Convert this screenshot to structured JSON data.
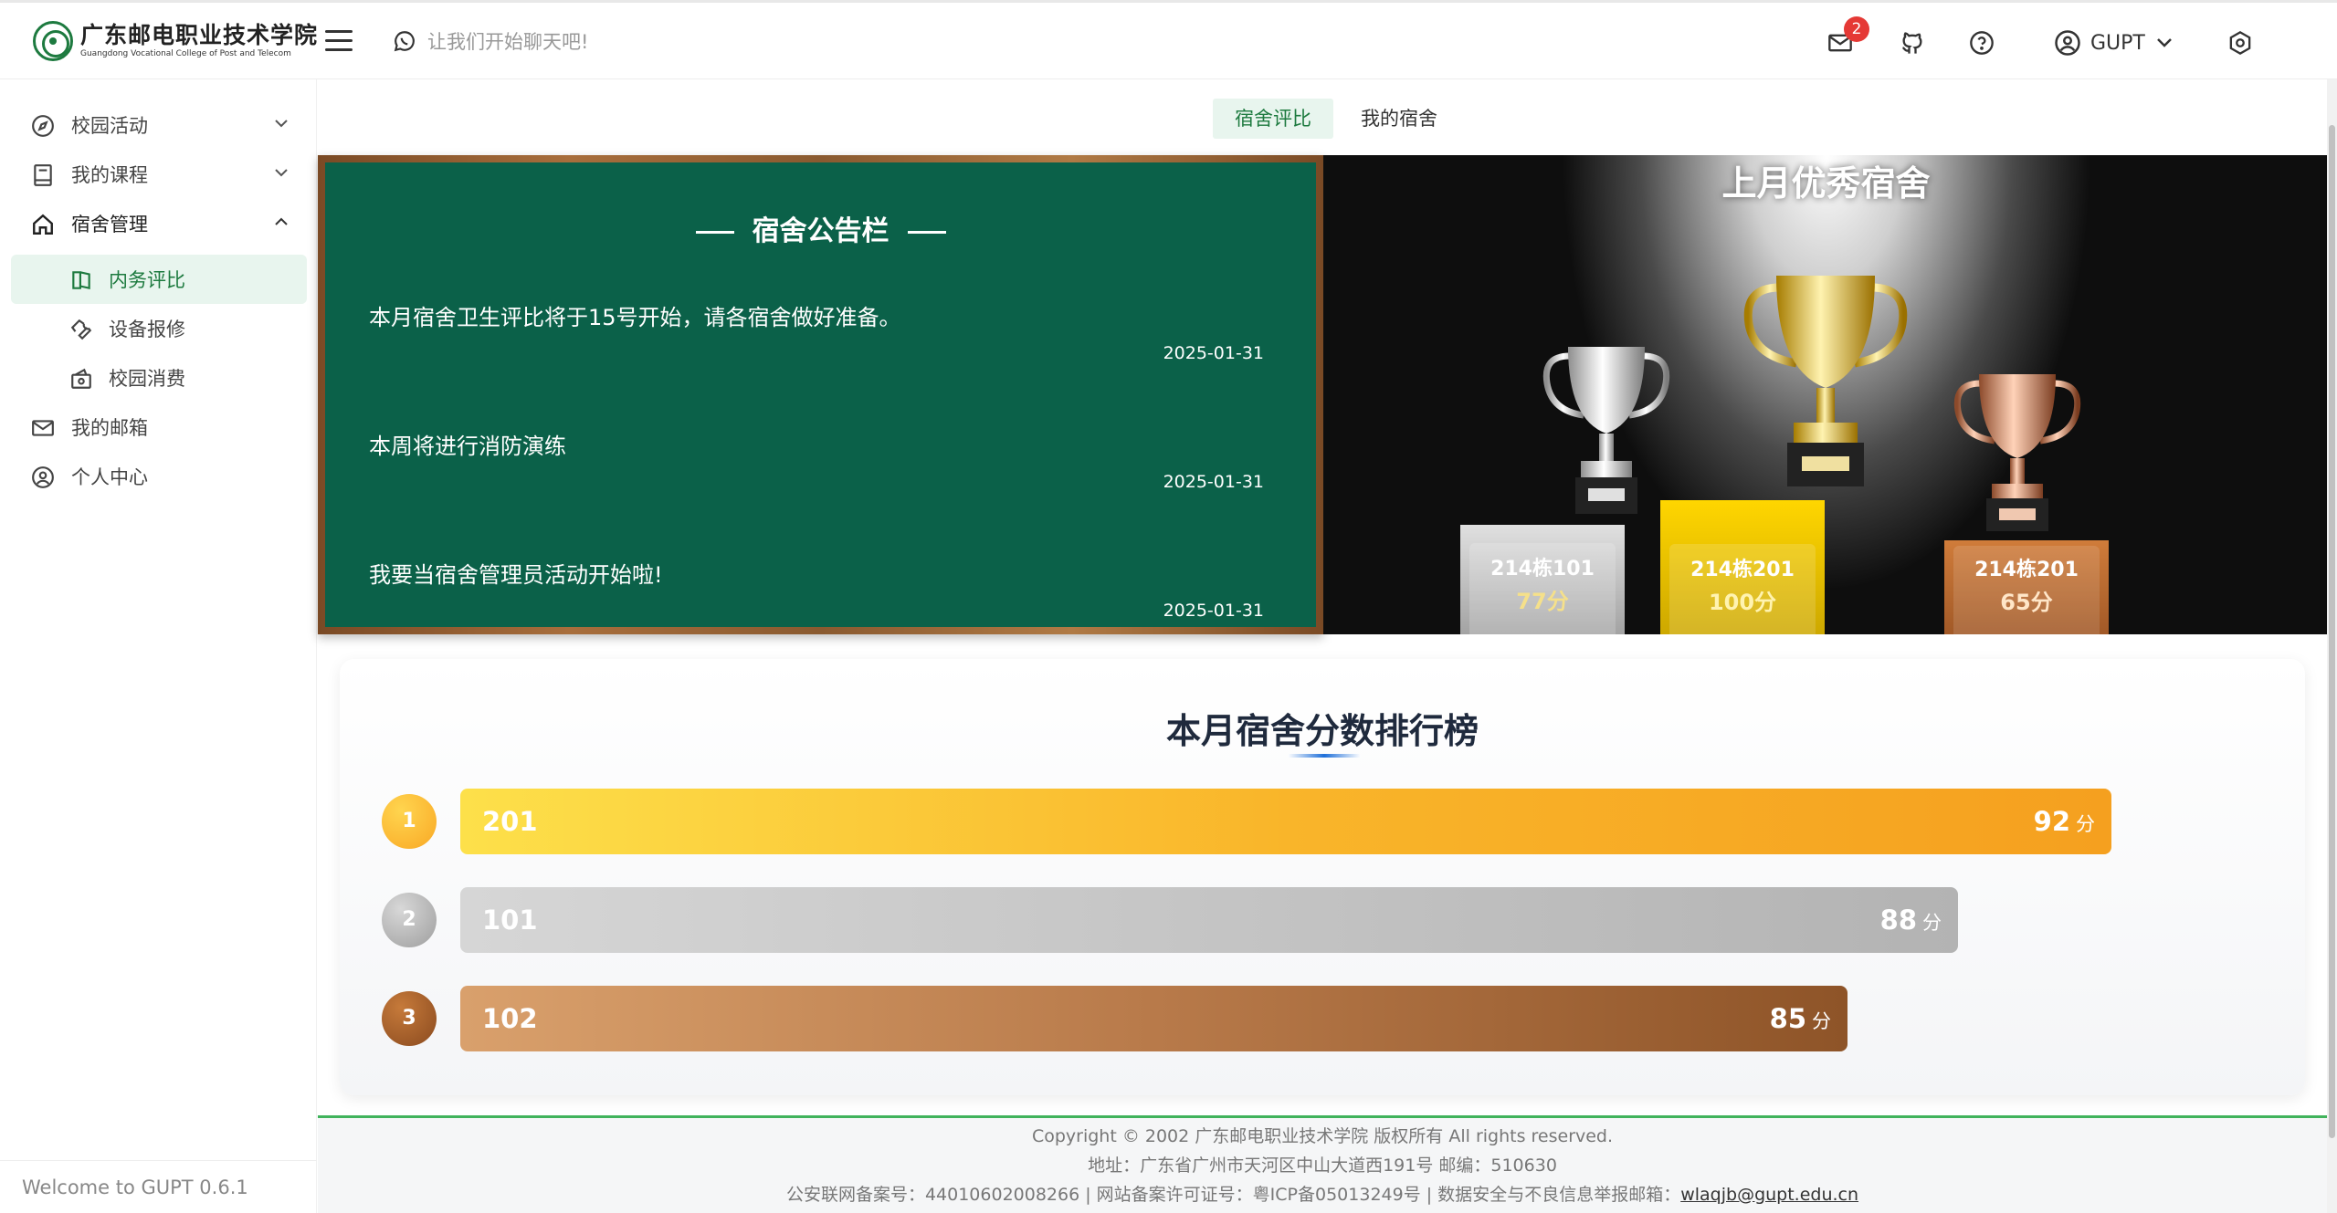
{
  "header": {
    "logo_cn": "广东邮电职业技术学院",
    "logo_en": "Guangdong Vocational College of Post and Telecom",
    "chat_placeholder": "让我们开始聊天吧!",
    "mail_badge": "2",
    "user_name": "GUPT"
  },
  "sidebar": {
    "items": [
      {
        "label": "校园活动"
      },
      {
        "label": "我的课程"
      },
      {
        "label": "宿舍管理"
      },
      {
        "label": "内务评比"
      },
      {
        "label": "设备报修"
      },
      {
        "label": "校园消费"
      },
      {
        "label": "我的邮箱"
      },
      {
        "label": "个人中心"
      }
    ],
    "welcome": "Welcome to GUPT 0.6.1"
  },
  "tabs": [
    {
      "label": "宿舍评比",
      "active": true
    },
    {
      "label": "我的宿舍",
      "active": false
    }
  ],
  "bulletin": {
    "title": "宿舍公告栏",
    "notices": [
      {
        "text": "本月宿舍卫生评比将于15号开始，请各宿舍做好准备。",
        "date": "2025-01-31"
      },
      {
        "text": "本周将进行消防演练",
        "date": "2025-01-31"
      },
      {
        "text": "我要当宿舍管理员活动开始啦!",
        "date": "2025-01-31"
      }
    ]
  },
  "trophies": {
    "title": "上月优秀宿舍",
    "podiums": [
      {
        "name": "214栋101",
        "score": "77分",
        "medal": "silver"
      },
      {
        "name": "214栋201",
        "score": "100分",
        "medal": "gold"
      },
      {
        "name": "214栋201",
        "score": "65分",
        "medal": "bronze"
      }
    ]
  },
  "ranking": {
    "title": "本月宿舍分数排行榜",
    "unit": "分",
    "max_score": 92,
    "rows": [
      {
        "rank": "1",
        "room": "201",
        "score": 92
      },
      {
        "rank": "2",
        "room": "101",
        "score": 88
      },
      {
        "rank": "3",
        "room": "102",
        "score": 85
      }
    ]
  },
  "footer": {
    "line1": "Copyright © 2002 广东邮电职业技术学院 版权所有 All rights reserved.",
    "line2": "地址：广东省广州市天河区中山大道西191号   邮编：510630",
    "line3": "公安联网备案号：44010602008266 | 网站备案许可证号：粤ICP备05013249号 | 数据安全与不良信息举报邮箱：",
    "email": "wlaqjb@gupt.edu.cn"
  },
  "colors": {
    "brand_green": "#1d7a3f",
    "board_green": "#0b6149",
    "gold": "#fbc02d",
    "silver": "#bdbdbd",
    "bronze": "#a0612f"
  }
}
